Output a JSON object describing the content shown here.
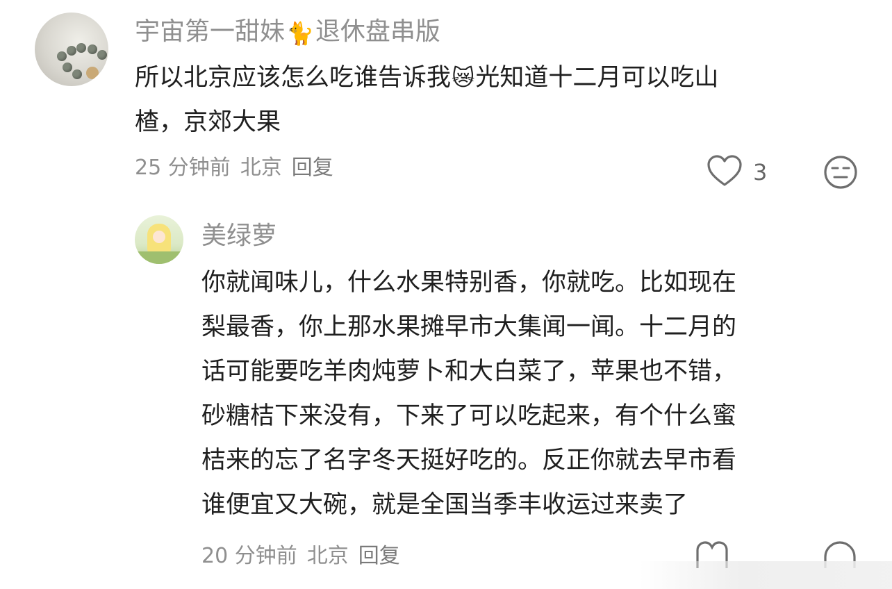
{
  "comment": {
    "username": "宇宙第一甜妹",
    "username_suffix": "退休盘串版",
    "username_emoji": "🐈",
    "text_part1": "所以北京应该怎么吃谁告诉我",
    "text_emoji": "😿",
    "text_part2": "光知道十二月可以吃山",
    "text_line2": "楂，京郊大果",
    "time": "25 分钟前",
    "location": "北京",
    "reply_label": "回复",
    "likes": "3"
  },
  "reply": {
    "username": "美绿萝",
    "lines": [
      "你就闻味儿，什么水果特别香，你就吃。比如现在",
      "梨最香，你上那水果摊早市大集闻一闻。十二月的",
      "话可能要吃羊肉炖萝卜和大白菜了，苹果也不错，",
      "砂糖桔下来没有，下来了可以吃起来，有个什么蜜",
      "桔来的忘了名字冬天挺好吃的。反正你就去早市看",
      "谁便宜又大碗，就是全国当季丰收运过来卖了"
    ],
    "time": "20 分钟前",
    "location": "北京",
    "reply_label": "回复"
  }
}
